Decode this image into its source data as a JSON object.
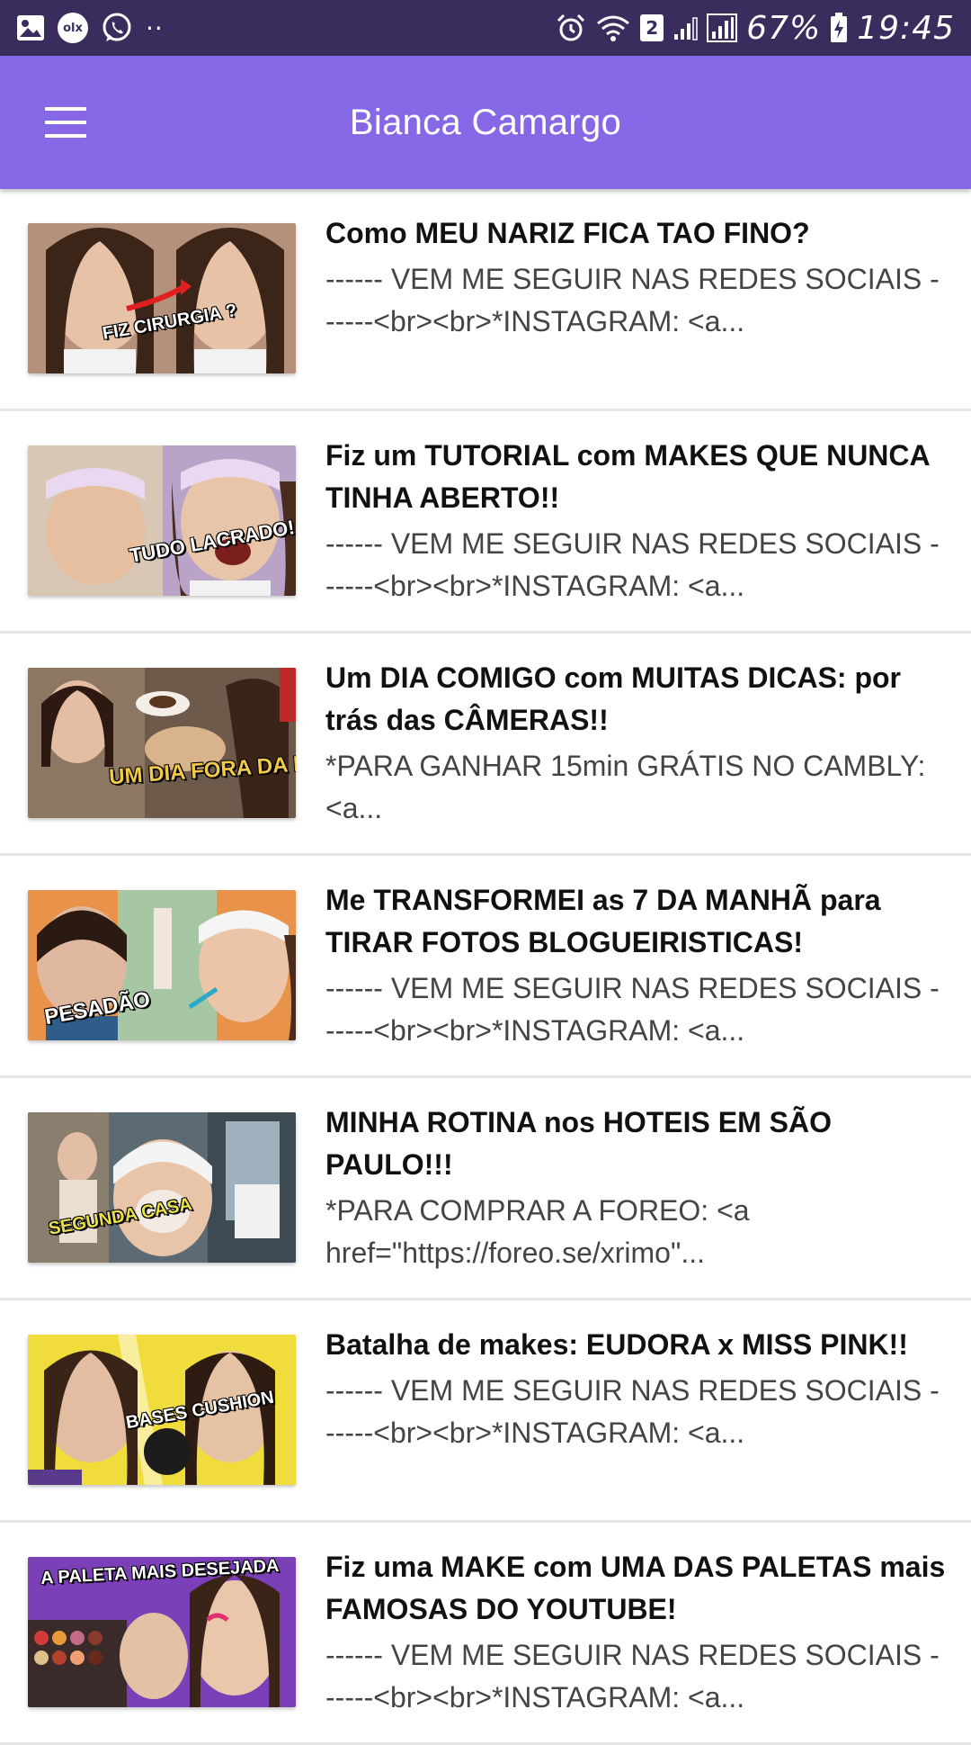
{
  "status_bar": {
    "left_icons": [
      "image-icon",
      "olx-icon",
      "whatsapp-icon",
      "more-dots-icon"
    ],
    "olx_label": "olx",
    "more_dots": "··",
    "sim_number": "2",
    "battery_percent": "67%",
    "time": "19:45"
  },
  "app_bar": {
    "title": "Bianca Camargo",
    "menu_icon": "hamburger-menu-icon"
  },
  "videos": [
    {
      "title": "Como MEU NARIZ FICA TAO FINO?",
      "description": "------ VEM ME SEGUIR NAS REDES SOCIAIS ------<br><br>*INSTAGRAM: <a...",
      "thumb_caption": "FIZ CIRURGIA ?"
    },
    {
      "title": "Fiz um TUTORIAL com MAKES QUE NUNCA TINHA ABERTO!!",
      "description": "------ VEM ME SEGUIR NAS REDES SOCIAIS ------<br><br>*INSTAGRAM: <a...",
      "thumb_caption": "TUDO LACRADO!"
    },
    {
      "title": "Um DIA COMIGO com MUITAS DICAS: por trás das CÂMERAS!!",
      "description": "*PARA GANHAR 15min GRÁTIS NO CAMBLY: <a...",
      "thumb_caption": "UM DIA FORA DA ROTINA"
    },
    {
      "title": "Me TRANSFORMEI as 7 DA MANHÃ para TIRAR FOTOS BLOGUEIRISTICAS!",
      "description": "------ VEM ME SEGUIR NAS REDES SOCIAIS ------<br><br>*INSTAGRAM: <a...",
      "thumb_caption": "PESADÃO"
    },
    {
      "title": "MINHA ROTINA nos HOTEIS EM SÃO PAULO!!!",
      "description": "*PARA COMPRAR A FOREO: <a href=\"https://foreo.se/xrimo\"...",
      "thumb_caption": "SEGUNDA CASA"
    },
    {
      "title": "Batalha de makes: EUDORA x MISS PINK!!",
      "description": "------ VEM ME SEGUIR NAS REDES SOCIAIS ------<br><br>*INSTAGRAM: <a...",
      "thumb_caption": "BASES CUSHION"
    },
    {
      "title": "Fiz uma MAKE com UMA DAS PALETAS mais FAMOSAS DO YOUTUBE!",
      "description": "------ VEM ME SEGUIR NAS REDES SOCIAIS ------<br><br>*INSTAGRAM: <a...",
      "thumb_caption": "A PALETA MAIS DESEJADA"
    }
  ],
  "colors": {
    "status_bar": "#3a2d5e",
    "app_bar": "#8668e6",
    "divider": "#e6e6e6"
  }
}
